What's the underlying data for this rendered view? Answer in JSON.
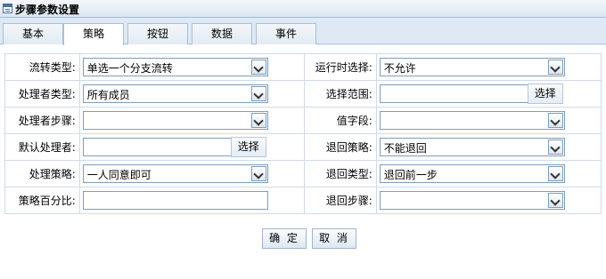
{
  "window": {
    "title": "步骤参数设置"
  },
  "tabs": [
    {
      "label": "基本"
    },
    {
      "label": "策略"
    },
    {
      "label": "按钮"
    },
    {
      "label": "数据"
    },
    {
      "label": "事件"
    }
  ],
  "form": {
    "flow_type": {
      "label": "流转类型:",
      "value": "单选一个分支流转"
    },
    "runtime_select": {
      "label": "运行时选择:",
      "value": "不允许"
    },
    "handler_type": {
      "label": "处理者类型:",
      "value": "所有成员"
    },
    "select_scope": {
      "label": "选择范围:",
      "value": "",
      "button": "选择"
    },
    "handler_step": {
      "label": "处理者步骤:",
      "value": ""
    },
    "value_field": {
      "label": "值字段:",
      "value": ""
    },
    "default_handler": {
      "label": "默认处理者:",
      "value": "",
      "button": "选择"
    },
    "return_strategy": {
      "label": "退回策略:",
      "value": "不能退回"
    },
    "handle_strategy": {
      "label": "处理策略:",
      "value": "一人同意即可"
    },
    "return_type": {
      "label": "退回类型:",
      "value": "退回前一步"
    },
    "strategy_percent": {
      "label": "策略百分比:",
      "value": ""
    },
    "return_step": {
      "label": "退回步骤:",
      "value": ""
    }
  },
  "actions": {
    "confirm": "确 定",
    "cancel": "取 消"
  }
}
